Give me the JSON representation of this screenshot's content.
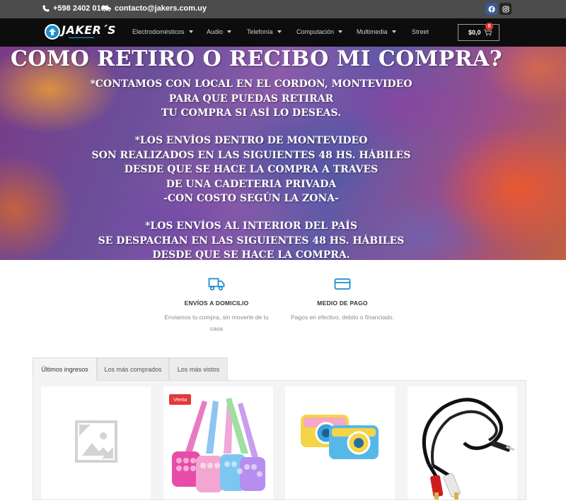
{
  "topbar": {
    "phone": "+598 2402 0161",
    "email": "contacto@jakers.com.uy",
    "phone_icon": "phone-icon",
    "email_icon": "truck-icon",
    "social": [
      "facebook-icon",
      "instagram-icon"
    ]
  },
  "nav": {
    "logo": "JAKER´S",
    "items": [
      {
        "label": "Electrodomésticos",
        "dropdown": true
      },
      {
        "label": "Audio",
        "dropdown": true
      },
      {
        "label": "Telefonía",
        "dropdown": true
      },
      {
        "label": "Computación",
        "dropdown": true
      },
      {
        "label": "Multimedia",
        "dropdown": true
      },
      {
        "label": "Street",
        "dropdown": false
      }
    ],
    "cart_total": "$0,0",
    "cart_count": "0"
  },
  "hero": {
    "title": "COMO RETIRO O RECIBO MI COMPRA?",
    "block1": [
      "*CONTAMOS CON LOCAL EN EL CORDON, MONTEVIDEO",
      "PARA QUE PUEDAS RETIRAR",
      "TU COMPRA SI ASÍ LO DESEAS."
    ],
    "block2": [
      "*LOS ENVÍOS DENTRO DE MONTEVIDEO",
      "SON REALIZADOS EN LAS SIGUIENTES 48 HS. HÁBILES",
      "DESDE QUE SE HACE LA COMPRA A TRAVES",
      "DE UNA CADETERIA PRIVADA",
      "-CON COSTO SEGÚN LA ZONA-"
    ],
    "block3": [
      "*LOS ENVÍOS AL INTERIOR DEL PAÍS",
      "SE DESPACHAN EN LAS SIGUIENTES 48 HS. HÁBILES",
      "DESDE QUE SE HACE LA COMPRA."
    ]
  },
  "features": [
    {
      "icon": "truck-icon",
      "title": "ENVÍOS A DOMICILIO",
      "desc": [
        "Enviamos tu compra, sin moverte de tu",
        "casa"
      ]
    },
    {
      "icon": "credit-card-icon",
      "title": "MEDIO DE PAGO",
      "desc": [
        "Pagos en efectivo, debito o financiado."
      ]
    }
  ],
  "tabs": [
    "Últimos ingresos",
    "Los más comprados",
    "Los más vistos"
  ],
  "products": [
    {
      "image": "placeholder-image-icon",
      "badge": ""
    },
    {
      "image": "pop-it-bags-image",
      "badge": "Venta"
    },
    {
      "image": "kids-camera-image",
      "badge": ""
    },
    {
      "image": "rca-cable-image",
      "badge": ""
    }
  ],
  "colors": {
    "topbar": "#4c4c4c",
    "nav": "#0d0d0d",
    "accent": "#1a8fd1",
    "sale": "#e23a3a"
  }
}
